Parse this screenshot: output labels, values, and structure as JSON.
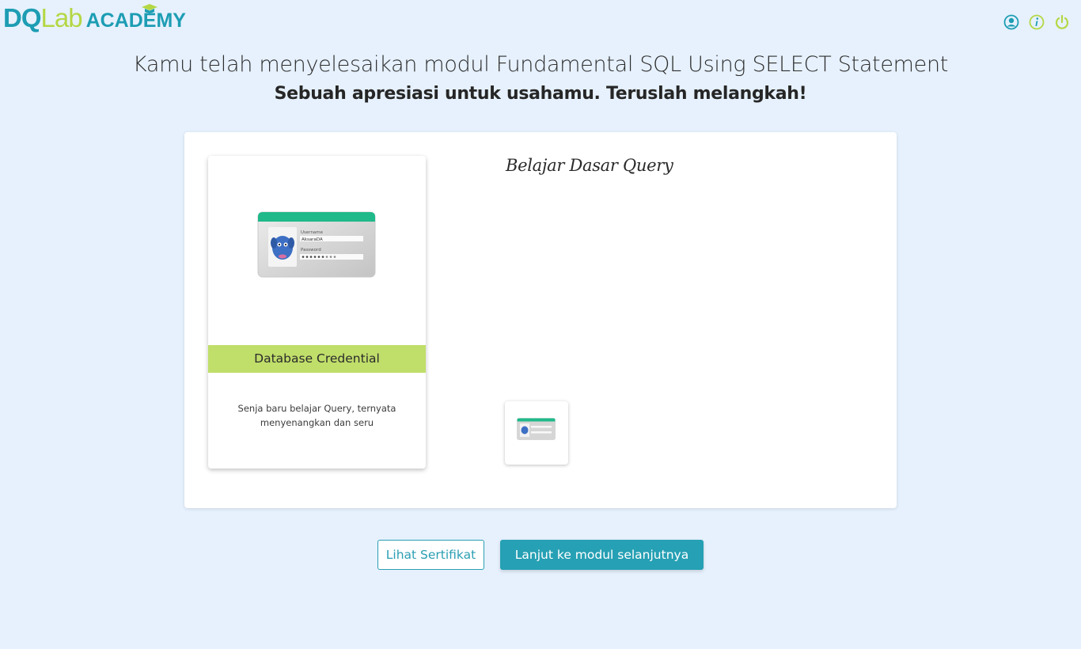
{
  "header": {
    "logo_dq": "DQ",
    "logo_lab": "Lab",
    "logo_academy": "ACADEMY",
    "icons": [
      "profile-icon",
      "info-icon",
      "power-icon"
    ]
  },
  "headline": "Kamu telah menyelesaikan modul Fundamental SQL Using SELECT Statement",
  "subline": "Sebuah apresiasi untuk usahamu. Teruslah melangkah!",
  "badge": {
    "image_username_label": "Username",
    "image_username_value": "AksaraDA",
    "image_password_label": "Password",
    "title": "Database Credential",
    "description": "Senja baru belajar Query, ternyata menyenangkan dan seru"
  },
  "section_title": "Belajar Dasar Query",
  "buttons": {
    "certificate": "Lihat Sertifikat",
    "next_module": "Lanjut ke modul selanjutnya"
  },
  "colors": {
    "background": "#e6f1fd",
    "brand_teal": "#1d9db3",
    "brand_green": "#b4d744",
    "badge_band": "#c0de6a",
    "primary_button": "#26a0b4"
  }
}
